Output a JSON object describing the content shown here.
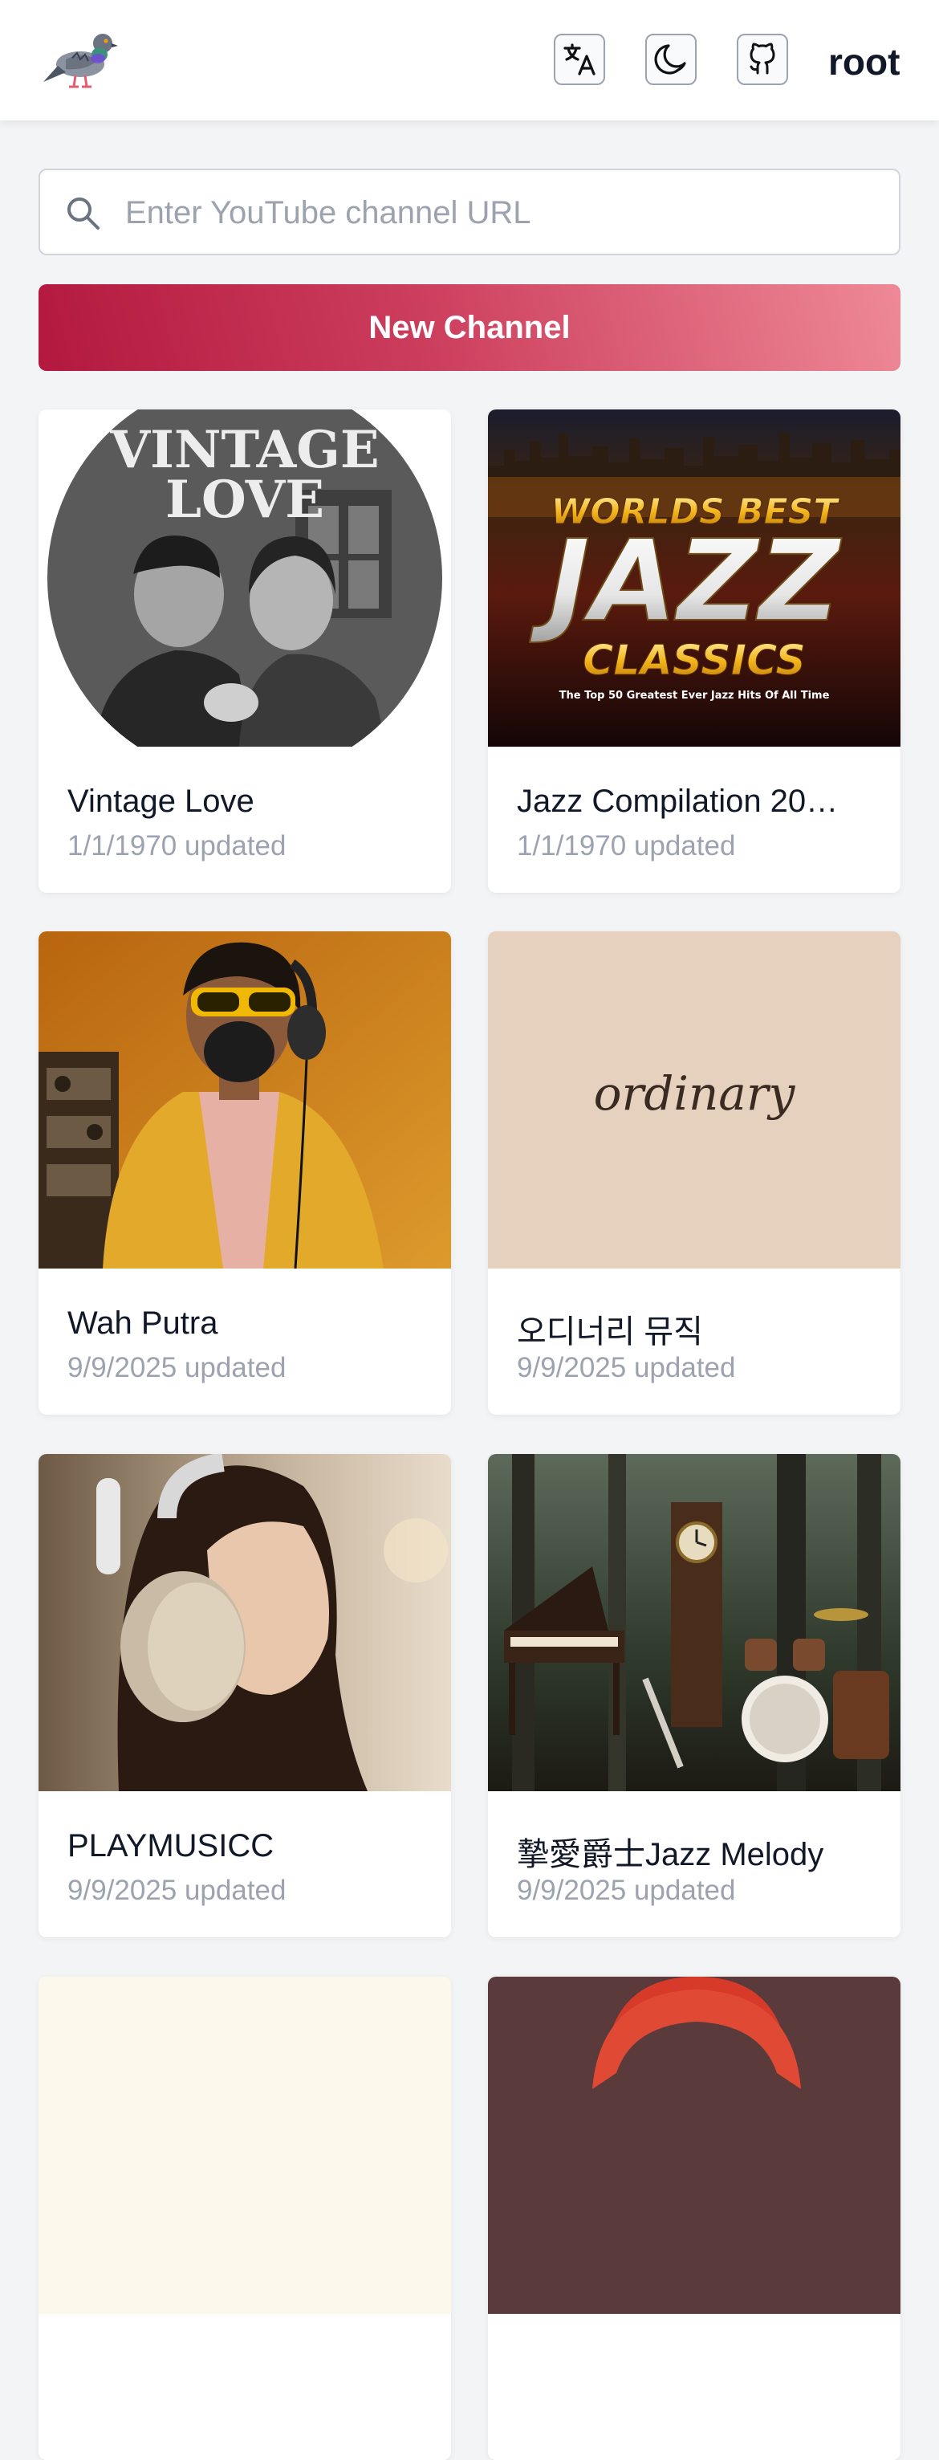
{
  "header": {
    "logo_icon": "pigeon-logo",
    "actions": [
      {
        "name": "translate-icon"
      },
      {
        "name": "moon-icon"
      },
      {
        "name": "github-icon"
      }
    ],
    "user": "root"
  },
  "search": {
    "placeholder": "Enter YouTube channel URL",
    "value": "",
    "icon": "search-icon"
  },
  "new_channel_label": "New Channel",
  "colors": {
    "accent_start": "#b3183e",
    "accent_end": "#ee8997",
    "muted_text": "#9ca3af"
  },
  "channels": [
    {
      "title": "Vintage Love",
      "updated": "1/1/1970 updated",
      "thumb_text": [
        "VINTAGE",
        "LOVE"
      ]
    },
    {
      "title": "Jazz Compilation 20…",
      "updated": "1/1/1970 updated",
      "thumb_text": [
        "WORLDS BEST",
        "JAZZ",
        "CLASSICS",
        "The Top 50 Greatest Ever Jazz Hits Of All Time"
      ]
    },
    {
      "title": "Wah Putra",
      "updated": "9/9/2025 updated"
    },
    {
      "title": "오디너리 뮤직",
      "updated": "9/9/2025 updated",
      "thumb_text": [
        "ordinary"
      ]
    },
    {
      "title": "PLAYMUSICC",
      "updated": "9/9/2025 updated"
    },
    {
      "title": "摯愛爵士Jazz Melody",
      "updated": "9/9/2025 updated"
    },
    {
      "title": "",
      "updated": ""
    },
    {
      "title": "",
      "updated": ""
    }
  ]
}
